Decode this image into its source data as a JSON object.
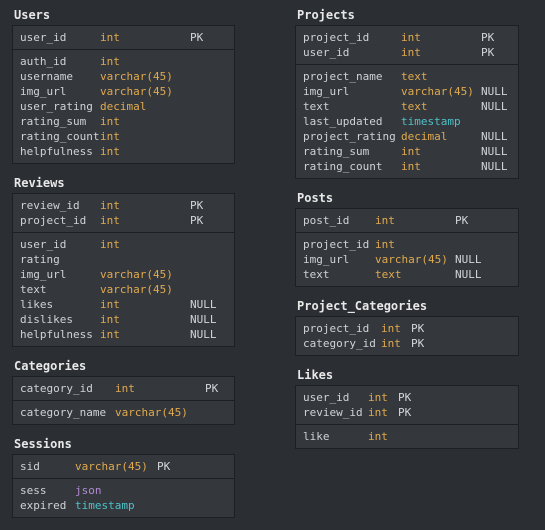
{
  "pk_label": "PK",
  "null_label": "NULL",
  "tables": {
    "users": {
      "title": "Users",
      "sections": [
        [
          {
            "name": "user_id",
            "type": "int",
            "type_class": "col-type-int",
            "flag": "PK"
          }
        ],
        [
          {
            "name": "auth_id",
            "type": "int",
            "type_class": "col-type-int"
          },
          {
            "name": "username",
            "type": "varchar(45)",
            "type_class": "col-type-varchar"
          },
          {
            "name": "img_url",
            "type": "varchar(45)",
            "type_class": "col-type-varchar"
          },
          {
            "name": "user_rating",
            "type": "decimal",
            "type_class": "col-type-decimal"
          },
          {
            "name": "rating_sum",
            "type": "int",
            "type_class": "col-type-int"
          },
          {
            "name": "rating_count",
            "type": "int",
            "type_class": "col-type-int"
          },
          {
            "name": "helpfulness",
            "type": "int",
            "type_class": "col-type-int"
          }
        ]
      ]
    },
    "reviews": {
      "title": "Reviews",
      "sections": [
        [
          {
            "name": "review_id",
            "type": "int",
            "type_class": "col-type-int",
            "flag": "PK"
          },
          {
            "name": "project_id",
            "type": "int",
            "type_class": "col-type-int",
            "flag": "PK"
          }
        ],
        [
          {
            "name": "user_id",
            "type": "int",
            "type_class": "col-type-int"
          },
          {
            "name": "rating",
            "type": "",
            "type_class": ""
          },
          {
            "name": "img_url",
            "type": "varchar(45)",
            "type_class": "col-type-varchar"
          },
          {
            "name": "text",
            "type": "varchar(45)",
            "type_class": "col-type-varchar"
          },
          {
            "name": "likes",
            "type": "int",
            "type_class": "col-type-int",
            "flag": "NULL"
          },
          {
            "name": "dislikes",
            "type": "int",
            "type_class": "col-type-int",
            "flag": "NULL"
          },
          {
            "name": "helpfulness",
            "type": "int",
            "type_class": "col-type-int",
            "flag": "NULL"
          }
        ]
      ]
    },
    "categories": {
      "title": "Categories",
      "sections": [
        [
          {
            "name": "category_id",
            "type": "int",
            "type_class": "col-type-int",
            "flag": "PK"
          }
        ],
        [
          {
            "name": "category_name",
            "type": "varchar(45)",
            "type_class": "col-type-varchar"
          }
        ]
      ]
    },
    "sessions": {
      "title": "Sessions",
      "sections": [
        [
          {
            "name": "sid",
            "type": "varchar(45)",
            "type_class": "col-type-varchar",
            "flag": "PK"
          }
        ],
        [
          {
            "name": "sess",
            "type": "json",
            "type_class": "col-type-json"
          },
          {
            "name": "expired",
            "type": "timestamp",
            "type_class": "col-type-timestamp"
          }
        ]
      ]
    },
    "projects": {
      "title": "Projects",
      "sections": [
        [
          {
            "name": "project_id",
            "type": "int",
            "type_class": "col-type-int",
            "flag": "PK"
          },
          {
            "name": "user_id",
            "type": "int",
            "type_class": "col-type-int",
            "flag": "PK"
          }
        ],
        [
          {
            "name": "project_name",
            "type": "text",
            "type_class": "col-type-text"
          },
          {
            "name": "img_url",
            "type": "varchar(45)",
            "type_class": "col-type-varchar",
            "flag": "NULL"
          },
          {
            "name": "text",
            "type": "text",
            "type_class": "col-type-text",
            "flag": "NULL"
          },
          {
            "name": "last_updated",
            "type": "timestamp",
            "type_class": "col-type-timestamp"
          },
          {
            "name": "project_rating",
            "type": "decimal",
            "type_class": "col-type-decimal",
            "flag": "NULL"
          },
          {
            "name": "rating_sum",
            "type": "int",
            "type_class": "col-type-int",
            "flag": "NULL"
          },
          {
            "name": "rating_count",
            "type": "int",
            "type_class": "col-type-int",
            "flag": "NULL"
          }
        ]
      ]
    },
    "posts": {
      "title": "Posts",
      "sections": [
        [
          {
            "name": "post_id",
            "type": "int",
            "type_class": "col-type-int",
            "flag": "PK"
          }
        ],
        [
          {
            "name": "project_id",
            "type": "int",
            "type_class": "col-type-int"
          },
          {
            "name": "img_url",
            "type": "varchar(45)",
            "type_class": "col-type-varchar",
            "flag": "NULL"
          },
          {
            "name": "text",
            "type": "text",
            "type_class": "col-type-text",
            "flag": "NULL"
          }
        ]
      ]
    },
    "project_categories": {
      "title": "Project_Categories",
      "sections": [
        [
          {
            "name": "project_id",
            "type": "int",
            "type_class": "col-type-int",
            "flag": "PK"
          },
          {
            "name": "category_id",
            "type": "int",
            "type_class": "col-type-int",
            "flag": "PK"
          }
        ]
      ]
    },
    "likes": {
      "title": "Likes",
      "sections": [
        [
          {
            "name": "user_id",
            "type": "int",
            "type_class": "col-type-int",
            "flag": "PK"
          },
          {
            "name": "review_id",
            "type": "int",
            "type_class": "col-type-int",
            "flag": "PK"
          }
        ],
        [
          {
            "name": "like",
            "type": "int",
            "type_class": "col-type-int"
          }
        ]
      ]
    }
  }
}
